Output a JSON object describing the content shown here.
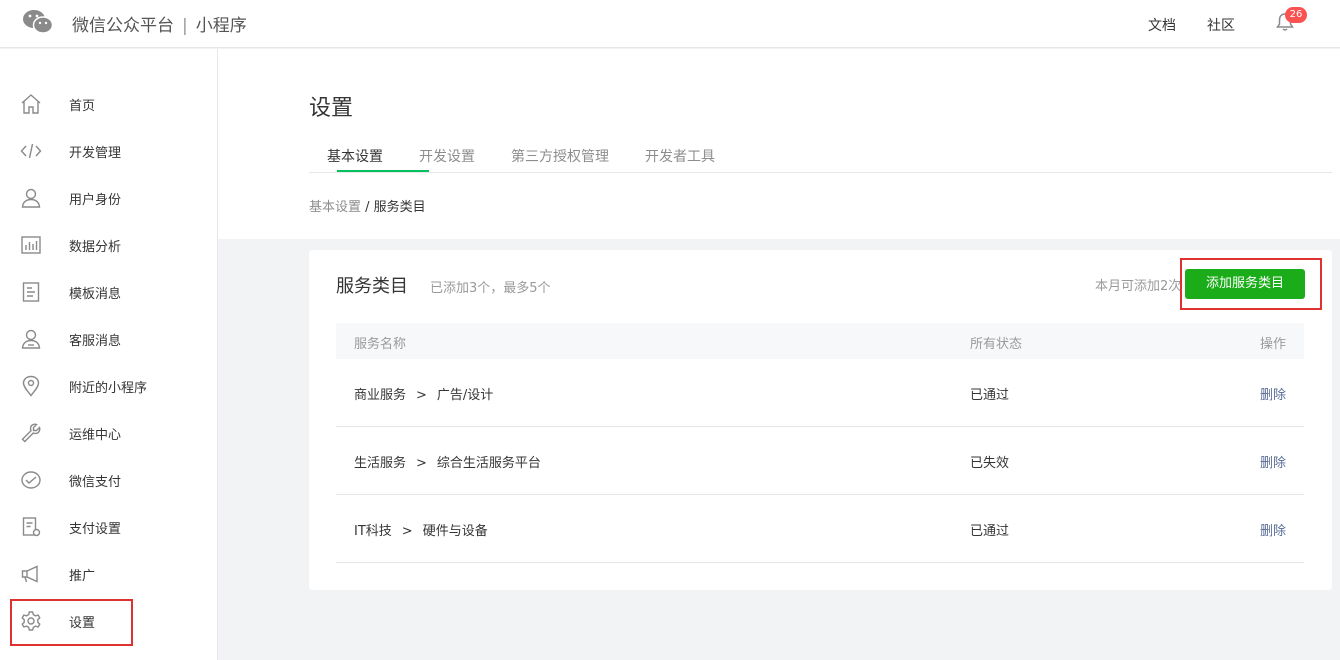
{
  "header": {
    "brand_main": "微信公众平台",
    "brand_sep": "|",
    "brand_sub": "小程序",
    "docs_link": "文档",
    "community_link": "社区",
    "notification_count": "26"
  },
  "sidebar": {
    "items": [
      {
        "label": "首页",
        "icon": "home-icon"
      },
      {
        "label": "开发管理",
        "icon": "code-icon"
      },
      {
        "label": "用户身份",
        "icon": "user-icon"
      },
      {
        "label": "数据分析",
        "icon": "chart-icon"
      },
      {
        "label": "模板消息",
        "icon": "document-icon"
      },
      {
        "label": "客服消息",
        "icon": "service-icon"
      },
      {
        "label": "附近的小程序",
        "icon": "location-icon"
      },
      {
        "label": "运维中心",
        "icon": "wrench-icon"
      },
      {
        "label": "微信支付",
        "icon": "pay-icon"
      },
      {
        "label": "支付设置",
        "icon": "pay-settings-icon"
      },
      {
        "label": "推广",
        "icon": "megaphone-icon"
      },
      {
        "label": "设置",
        "icon": "gear-icon"
      }
    ],
    "selected": "设置"
  },
  "main": {
    "title": "设置",
    "tabs": [
      {
        "label": "基本设置",
        "active": true
      },
      {
        "label": "开发设置",
        "active": false
      },
      {
        "label": "第三方授权管理",
        "active": false
      },
      {
        "label": "开发者工具",
        "active": false
      }
    ],
    "breadcrumb": {
      "parent": "基本设置",
      "sep": " / ",
      "current": "服务类目"
    },
    "card": {
      "title": "服务类目",
      "subtitle": "已添加3个，最多5个",
      "quota": "本月可添加2次",
      "add_button": "添加服务类目",
      "columns": [
        "服务名称",
        "所有状态",
        "操作"
      ],
      "rows": [
        {
          "category": "商业服务",
          "arrow": ">",
          "subcategory": "广告/设计",
          "status": "已通过",
          "action": "删除"
        },
        {
          "category": "生活服务",
          "arrow": ">",
          "subcategory": "综合生活服务平台",
          "status": "已失效",
          "action": "删除"
        },
        {
          "category": "IT科技",
          "arrow": ">",
          "subcategory": "硬件与设备",
          "status": "已通过",
          "action": "删除"
        }
      ]
    }
  },
  "colors": {
    "accent_green": "#1aad19",
    "tab_underline": "#07c160",
    "highlight_red": "#e03131",
    "link_blue": "#576b95",
    "badge_red": "#fa5151"
  }
}
